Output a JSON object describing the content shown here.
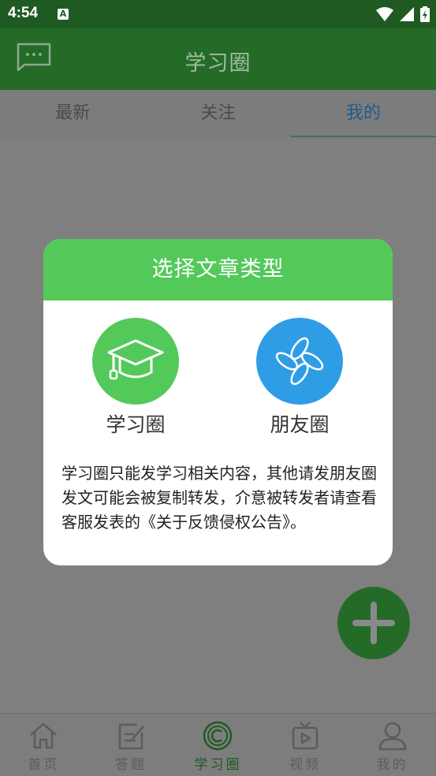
{
  "status_bar": {
    "time": "4:54",
    "notification_glyph": "A"
  },
  "app_bar": {
    "title": "学习圈"
  },
  "tabs": [
    {
      "label": "最新",
      "active": false
    },
    {
      "label": "关注",
      "active": false
    },
    {
      "label": "我的",
      "active": true
    }
  ],
  "dialog": {
    "title": "选择文章类型",
    "options": [
      {
        "label": "学习圈",
        "icon": "graduation-cap-icon",
        "color": "#53c95a"
      },
      {
        "label": "朋友圈",
        "icon": "pinwheel-icon",
        "color": "#2f9de6"
      }
    ],
    "notes": [
      "学习圈只能发学习相关内容，其他请发朋友圈",
      "发文可能会被复制转发，介意被转发者请查看客服发表的《关于反馈侵权公告》。"
    ]
  },
  "bottom_nav": [
    {
      "label": "首页",
      "icon": "home-icon"
    },
    {
      "label": "答题",
      "icon": "edit-icon"
    },
    {
      "label": "学习圈",
      "icon": "circle-c-icon",
      "active": true
    },
    {
      "label": "视频",
      "icon": "tv-icon"
    },
    {
      "label": "我的",
      "icon": "user-icon"
    }
  ],
  "colors": {
    "primary_dark": "#256b28",
    "dialog_header": "#53c95a",
    "friends_blue": "#2f9de6",
    "overlay_gray": "#7f7f7f"
  }
}
